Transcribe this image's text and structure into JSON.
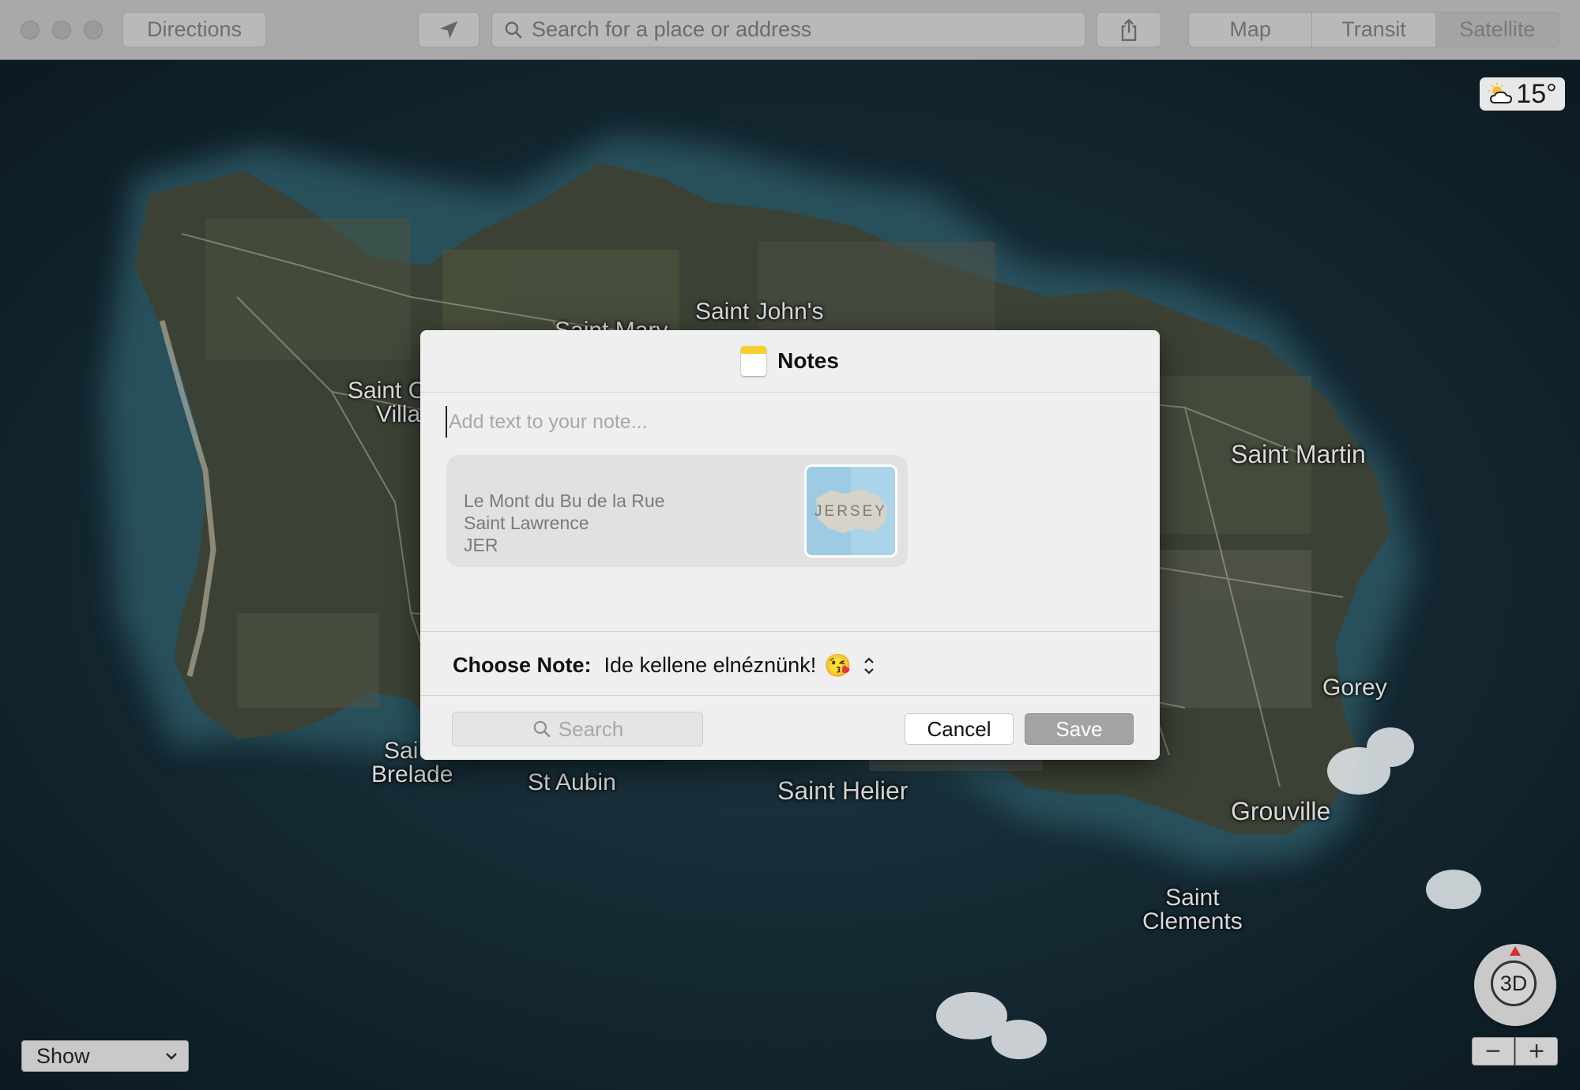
{
  "toolbar": {
    "directions_label": "Directions",
    "search_placeholder": "Search for a place or address",
    "map_modes": [
      "Map",
      "Transit",
      "Satellite"
    ],
    "selected_mode": "Satellite"
  },
  "map": {
    "weather": {
      "temperature": "15°",
      "icon": "partly-cloudy-icon"
    },
    "places": {
      "saint_johns": "Saint John's",
      "saint_marys": "Saint Mary",
      "saint_ouen_line1": "Saint O",
      "saint_ouen_line2": "Villa",
      "saint_martin": "Saint Martin",
      "gorey": "Gorey",
      "saint_brelade_line1": "Sai",
      "saint_brelade_line2": "Brelade",
      "st_aubin": "St Aubin",
      "saint_helier": "Saint Helier",
      "grouville": "Grouville",
      "saint_clements_line1": "Saint",
      "saint_clements_line2": "Clements"
    },
    "compass_label": "3D",
    "zoom_out": "−",
    "zoom_in": "+",
    "show_select": "Show"
  },
  "dialog": {
    "title": "Notes",
    "note_placeholder": "Add text to your note...",
    "address": {
      "line1": "Le Mont du Bu de la Rue",
      "line2": "Saint Lawrence",
      "line3": "JER"
    },
    "thumbnail_label": "JERSEY",
    "choose_label": "Choose Note:",
    "choose_value": "Ide kellene elnéznünk!",
    "choose_emoji": "😘",
    "search_placeholder": "Search",
    "cancel_label": "Cancel",
    "save_label": "Save"
  }
}
